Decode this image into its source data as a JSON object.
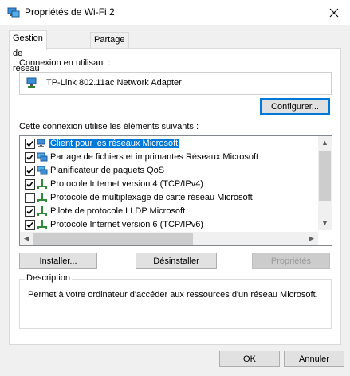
{
  "window": {
    "title": "Propriétés de Wi-Fi 2"
  },
  "tabs": [
    {
      "label": "Gestion de réseau"
    },
    {
      "label": "Partage"
    }
  ],
  "connect_using": {
    "label": "Connexion en utilisant :",
    "adapter": "TP-Link 802.11ac Network Adapter",
    "configure_button": "Configurer..."
  },
  "items_section": {
    "label": "Cette connexion utilise les éléments suivants :",
    "items": [
      {
        "label": "Client pour les réseaux Microsoft",
        "checked": true,
        "icon": "network-client-icon"
      },
      {
        "label": "Partage de fichiers et imprimantes Réseaux Microsoft",
        "checked": true,
        "icon": "network-service-icon"
      },
      {
        "label": "Planificateur de paquets QoS",
        "checked": true,
        "icon": "network-service-icon"
      },
      {
        "label": "Protocole Internet version 4 (TCP/IPv4)",
        "checked": true,
        "icon": "protocol-icon"
      },
      {
        "label": "Protocole de multiplexage de carte réseau Microsoft",
        "checked": false,
        "icon": "protocol-icon"
      },
      {
        "label": "Pilote de protocole LLDP Microsoft",
        "checked": true,
        "icon": "protocol-icon"
      },
      {
        "label": "Protocole Internet version 6 (TCP/IPv6)",
        "checked": true,
        "icon": "protocol-icon"
      }
    ]
  },
  "buttons": {
    "install": "Installer...",
    "uninstall": "Désinstaller",
    "properties": "Propriétés",
    "ok": "OK",
    "cancel": "Annuler"
  },
  "description": {
    "legend": "Description",
    "text": "Permet à votre ordinateur d'accéder aux ressources d'un réseau Microsoft."
  },
  "colors": {
    "accent": "#0078d7",
    "selected_bg": "#0078d7"
  }
}
